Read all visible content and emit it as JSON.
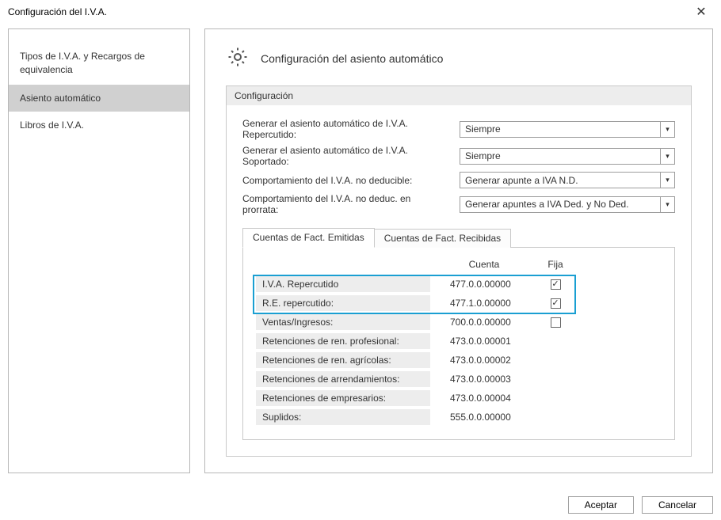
{
  "window": {
    "title": "Configuración del I.V.A."
  },
  "sidebar": {
    "items": [
      {
        "label": "Tipos de I.V.A. y Recargos de equivalencia",
        "selected": false
      },
      {
        "label": "Asiento automático",
        "selected": true
      },
      {
        "label": "Libros de I.V.A.",
        "selected": false
      }
    ]
  },
  "main": {
    "header": "Configuración del asiento automático",
    "panel_subhead": "Configuración",
    "fields": [
      {
        "label": "Generar el asiento automático de I.V.A. Repercutido:",
        "value": "Siempre"
      },
      {
        "label": "Generar el asiento automático de I.V.A. Soportado:",
        "value": "Siempre"
      },
      {
        "label": "Comportamiento del I.V.A. no deducible:",
        "value": "Generar apunte a IVA N.D."
      },
      {
        "label": "Comportamiento del I.V.A. no deduc. en prorrata:",
        "value": "Generar apuntes a IVA Ded. y No Ded."
      }
    ],
    "tabs": [
      {
        "label": "Cuentas de Fact. Emitidas",
        "active": true
      },
      {
        "label": "Cuentas de Fact. Recibidas",
        "active": false
      }
    ],
    "grid": {
      "col_cuenta": "Cuenta",
      "col_fija": "Fija",
      "rows": [
        {
          "label": "I.V.A. Repercutido",
          "cuenta": "477.0.0.00000",
          "fija": true,
          "highlight": true
        },
        {
          "label": "R.E. repercutido:",
          "cuenta": "477.1.0.00000",
          "fija": true,
          "highlight": true
        },
        {
          "label": "Ventas/Ingresos:",
          "cuenta": "700.0.0.00000",
          "fija": false,
          "has_fija": true
        },
        {
          "label": "Retenciones de ren. profesional:",
          "cuenta": "473.0.0.00001"
        },
        {
          "label": "Retenciones de ren. agrícolas:",
          "cuenta": "473.0.0.00002"
        },
        {
          "label": "Retenciones de arrendamientos:",
          "cuenta": "473.0.0.00003"
        },
        {
          "label": "Retenciones de empresarios:",
          "cuenta": "473.0.0.00004"
        },
        {
          "label": "Suplidos:",
          "cuenta": "555.0.0.00000"
        }
      ]
    }
  },
  "buttons": {
    "accept": "Aceptar",
    "cancel": "Cancelar"
  },
  "colors": {
    "highlight": "#1a9fd2",
    "shade": "#ededed"
  }
}
